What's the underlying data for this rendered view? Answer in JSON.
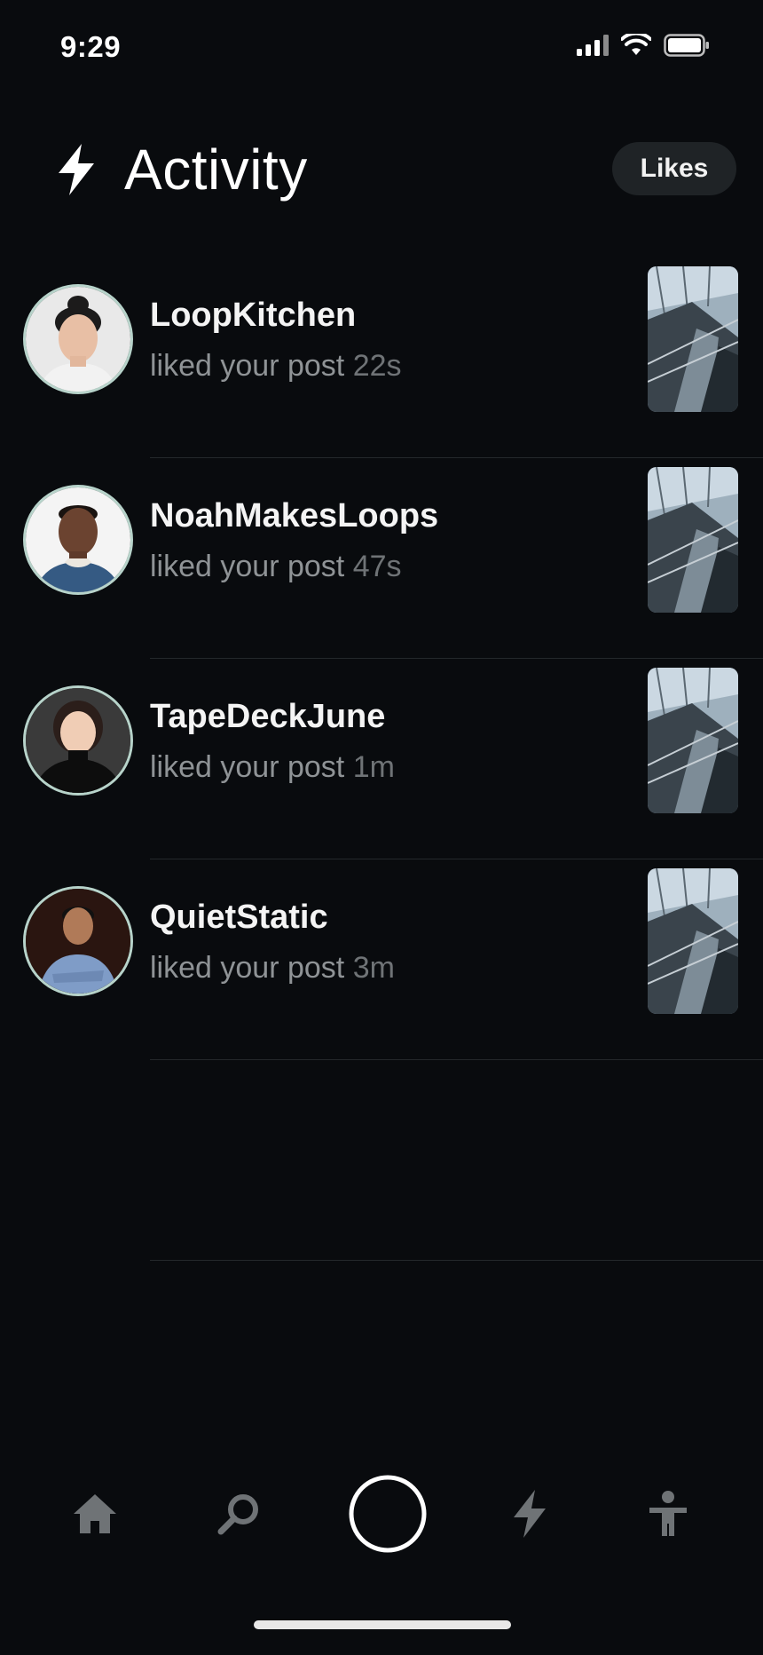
{
  "status": {
    "time": "9:29"
  },
  "header": {
    "title": "Activity",
    "filter_label": "Likes"
  },
  "activity": [
    {
      "user": "LoopKitchen",
      "action": "liked your post",
      "time": "22s"
    },
    {
      "user": "NoahMakesLoops",
      "action": "liked your post",
      "time": "47s"
    },
    {
      "user": "TapeDeckJune",
      "action": "liked your post",
      "time": "1m"
    },
    {
      "user": "QuietStatic",
      "action": "liked your post",
      "time": "3m"
    }
  ],
  "tabbar": {
    "items": [
      "home-icon",
      "search-icon",
      "record-icon",
      "activity-icon",
      "profile-icon"
    ]
  },
  "colors": {
    "background": "#090b0e",
    "avatar_ring": "#b7d3ca",
    "pill": "#1f2326",
    "muted_text": "#8f9396"
  }
}
